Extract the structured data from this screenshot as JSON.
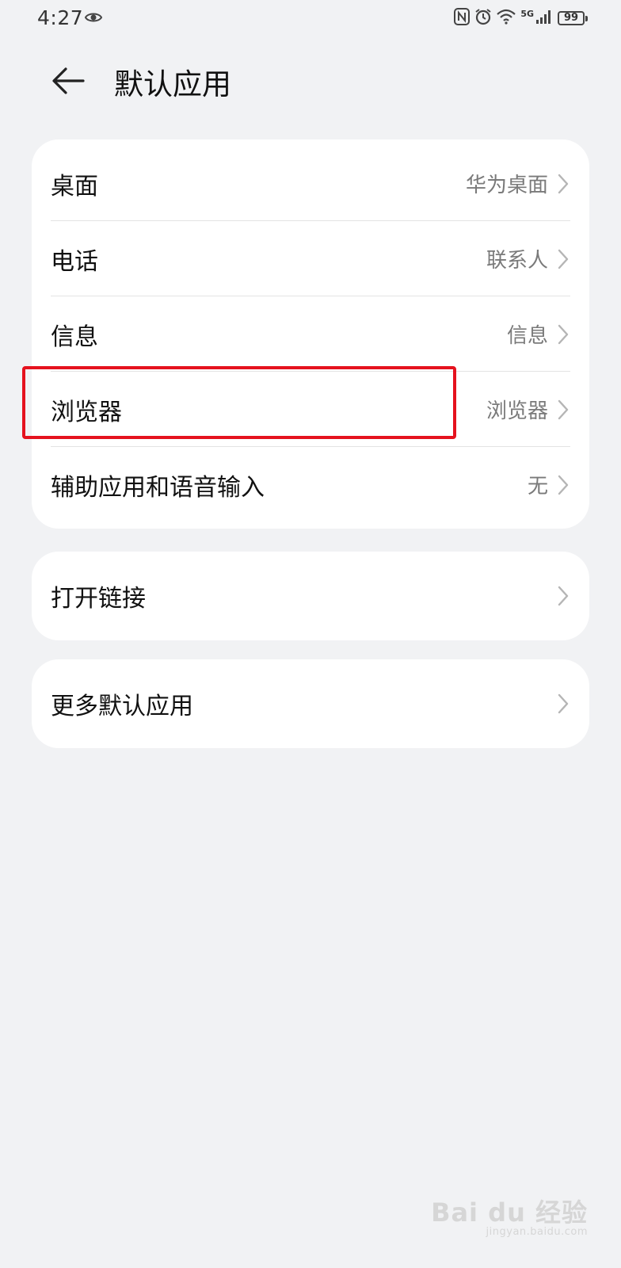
{
  "status_bar": {
    "time": "4:27",
    "network": "5G",
    "battery": "99",
    "icons": [
      "eye-icon",
      "nfc-icon",
      "alarm-icon",
      "wifi-icon",
      "signal-icon",
      "battery-icon"
    ]
  },
  "header": {
    "back_icon": "arrow-left-icon",
    "title": "默认应用"
  },
  "section1": {
    "rows": [
      {
        "label": "桌面",
        "value": "华为桌面"
      },
      {
        "label": "电话",
        "value": "联系人"
      },
      {
        "label": "信息",
        "value": "信息"
      },
      {
        "label": "浏览器",
        "value": "浏览器"
      },
      {
        "label": "辅助应用和语音输入",
        "value": "无"
      }
    ]
  },
  "section2": {
    "label": "打开链接"
  },
  "section3": {
    "label": "更多默认应用"
  },
  "highlight_color": "#e5121e",
  "watermark": {
    "main": "Bai du 经验",
    "sub": "jingyan.baidu.com"
  }
}
